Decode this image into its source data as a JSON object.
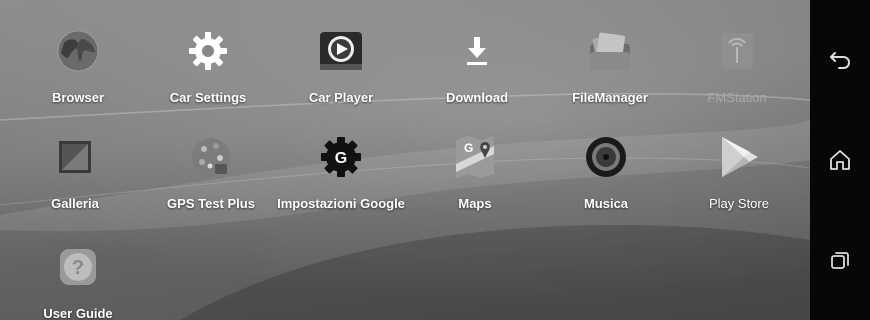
{
  "apps": [
    {
      "label": "Browser",
      "icon": "globe-icon"
    },
    {
      "label": "Car Settings",
      "icon": "gear-icon"
    },
    {
      "label": "Car Player",
      "icon": "play-icon"
    },
    {
      "label": "Download",
      "icon": "download-icon"
    },
    {
      "label": "FileManager",
      "icon": "folder-icon"
    },
    {
      "label": "FMStation",
      "icon": "radio-icon"
    },
    {
      "label": "Galleria",
      "icon": "gallery-icon"
    },
    {
      "label": "GPS Test Plus",
      "icon": "gps-icon"
    },
    {
      "label": "Impostazioni Google",
      "icon": "google-settings-icon"
    },
    {
      "label": "Maps",
      "icon": "maps-icon"
    },
    {
      "label": "Musica",
      "icon": "music-icon"
    },
    {
      "label": "Play Store",
      "icon": "play-store-icon"
    },
    {
      "label": "User Guide",
      "icon": "help-icon"
    }
  ],
  "nav": {
    "back_icon": "back-arrow-icon",
    "home_icon": "home-icon",
    "recents_icon": "recents-icon"
  }
}
